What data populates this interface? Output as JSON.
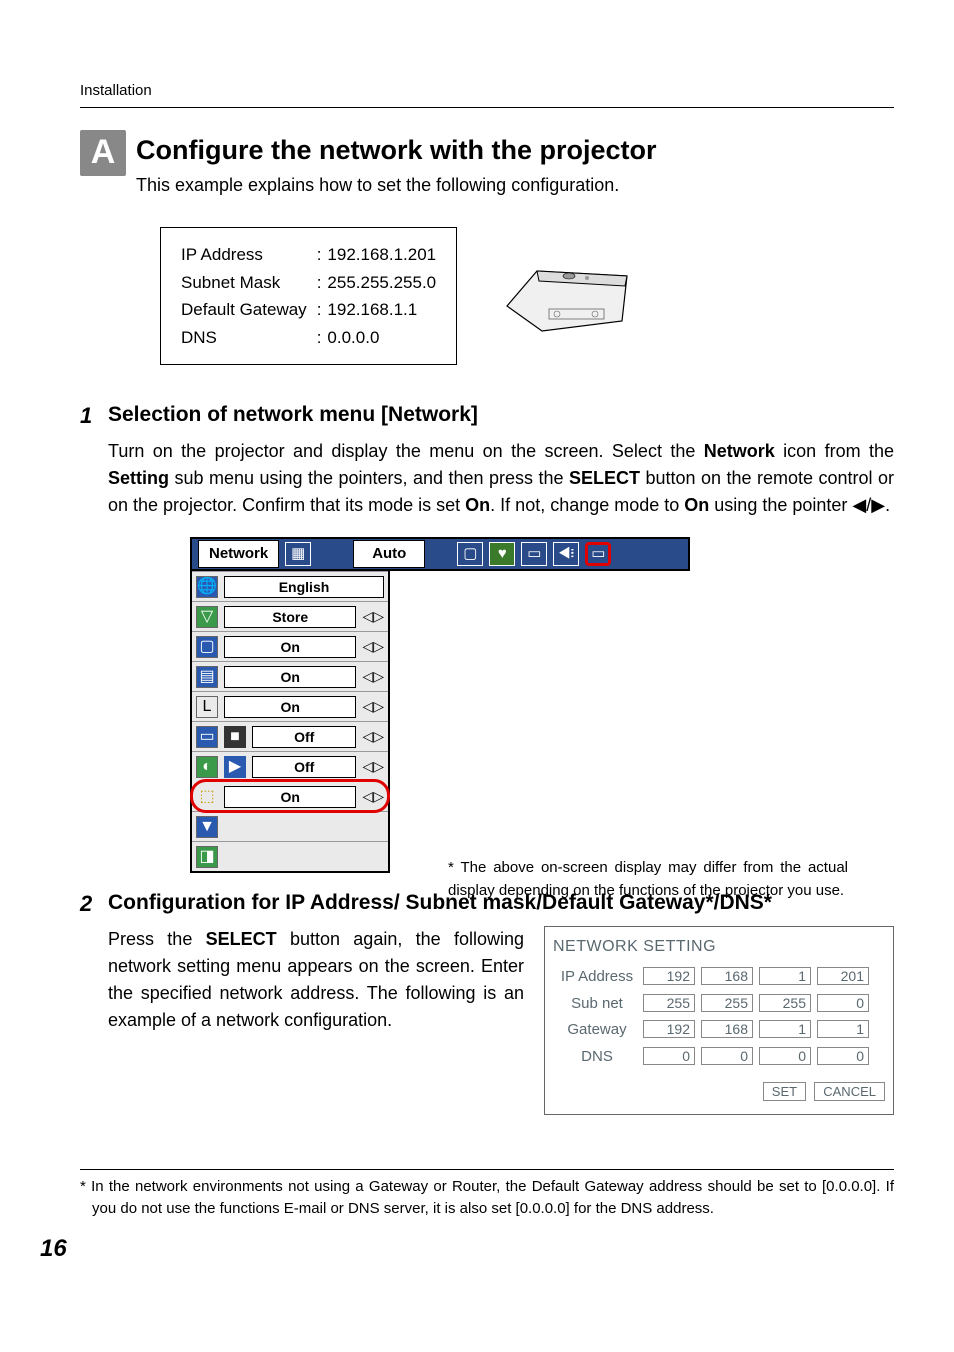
{
  "header": {
    "section": "Installation"
  },
  "block_a": {
    "badge": "A",
    "title": "Configure the network with the projector",
    "sub": "This example explains how to set the following configuration."
  },
  "config_box": {
    "rows": [
      {
        "k": "IP Address",
        "v": "192.168.1.201"
      },
      {
        "k": "Subnet Mask",
        "v": "255.255.255.0"
      },
      {
        "k": "Default Gateway",
        "v": "192.168.1.1"
      },
      {
        "k": "DNS",
        "v": "0.0.0.0"
      }
    ]
  },
  "step1": {
    "num": "1",
    "title": "Selection of network menu [Network]",
    "body_parts": [
      "Turn on the projector and display the menu on the screen. Select the ",
      "Network",
      " icon from the ",
      "Setting",
      " sub menu using the pointers, and then press the ",
      "SELECT",
      " button on the remote control or on the projector. Confirm that its mode is set ",
      "On",
      ". If not, change mode to ",
      "On",
      " using the pointer ◀/▶."
    ],
    "menu_bar": {
      "label": "Network",
      "center": "Auto"
    },
    "menu_rows": [
      {
        "value": "English",
        "arrows": false
      },
      {
        "value": "Store",
        "arrows": true
      },
      {
        "value": "On",
        "arrows": true
      },
      {
        "value": "On",
        "arrows": true
      },
      {
        "value": "On",
        "arrows": true
      },
      {
        "value": "Off",
        "arrows": true
      },
      {
        "value": "Off",
        "arrows": true
      },
      {
        "value": "On",
        "arrows": true,
        "highlight": true
      }
    ],
    "caption": "* The above on-screen display may differ from the actual display depending on the functions of the projector you use."
  },
  "step2": {
    "num": "2",
    "title": "Configuration for IP Address/ Subnet mask/Default Gateway*/DNS*",
    "body_parts": [
      "Press the ",
      "SELECT",
      " button again, the following network setting menu appears on the screen. Enter the specified network address. The following is an example of a network configuration."
    ],
    "netset": {
      "title": "NETWORK SETTING",
      "rows": [
        {
          "label": "IP Address",
          "o": [
            "192",
            "168",
            "1",
            "201"
          ]
        },
        {
          "label": "Sub net",
          "o": [
            "255",
            "255",
            "255",
            "0"
          ]
        },
        {
          "label": "Gateway",
          "o": [
            "192",
            "168",
            "1",
            "1"
          ]
        },
        {
          "label": "DNS",
          "o": [
            "0",
            "0",
            "0",
            "0"
          ]
        }
      ],
      "set": "SET",
      "cancel": "CANCEL"
    }
  },
  "footnote": "* In the network environments not using a Gateway or Router, the Default Gateway address should be set to [0.0.0.0]. If you do not use the functions E-mail or DNS server, it is also set [0.0.0.0] for the DNS address.",
  "page": "16"
}
